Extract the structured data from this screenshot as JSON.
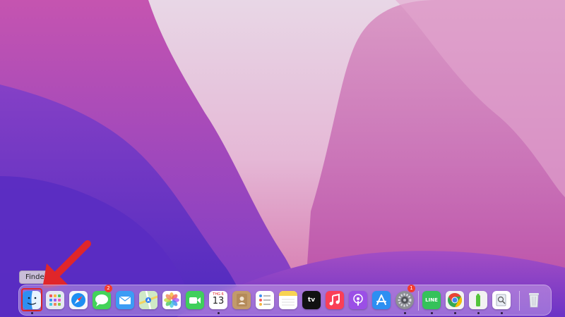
{
  "desktop": {
    "wallpaper": "macOS Monterey"
  },
  "tooltip": {
    "label": "Finder"
  },
  "annotation": {
    "arrow_color": "#e0262a",
    "highlight_color": "#e0262a"
  },
  "dock": {
    "apps": [
      {
        "id": "finder",
        "icon": "finder-icon",
        "running": true,
        "highlighted": true
      },
      {
        "id": "launchpad",
        "icon": "launchpad-icon",
        "running": false
      },
      {
        "id": "safari",
        "icon": "safari-icon",
        "running": false
      },
      {
        "id": "messages",
        "icon": "messages-icon",
        "running": false,
        "badge": "2"
      },
      {
        "id": "mail",
        "icon": "mail-icon",
        "running": false
      },
      {
        "id": "maps",
        "icon": "maps-icon",
        "running": false
      },
      {
        "id": "photos",
        "icon": "photos-icon",
        "running": false
      },
      {
        "id": "facetime",
        "icon": "facetime-icon",
        "running": false
      },
      {
        "id": "calendar",
        "icon": "calendar-icon",
        "running": true,
        "month": "THG 6",
        "day": "13"
      },
      {
        "id": "contacts",
        "icon": "contacts-icon",
        "running": false
      },
      {
        "id": "reminders",
        "icon": "reminders-icon",
        "running": false
      },
      {
        "id": "notes",
        "icon": "notes-icon",
        "running": false
      },
      {
        "id": "appletv",
        "icon": "tv-icon",
        "running": false,
        "label": "tv"
      },
      {
        "id": "music",
        "icon": "music-icon",
        "running": false
      },
      {
        "id": "podcasts",
        "icon": "podcasts-icon",
        "running": false
      },
      {
        "id": "appstore",
        "icon": "app-store-icon",
        "running": false
      },
      {
        "id": "system-preferences",
        "icon": "gear-icon",
        "running": true,
        "badge": "1"
      },
      {
        "id": "line",
        "icon": "line-icon",
        "running": true,
        "label": "LINE"
      },
      {
        "id": "chrome",
        "icon": "chrome-icon",
        "running": true
      },
      {
        "id": "battery-app",
        "icon": "battery-icon",
        "running": true
      },
      {
        "id": "preview",
        "icon": "preview-icon",
        "running": true
      },
      {
        "id": "trash",
        "icon": "trash-icon",
        "running": false
      }
    ]
  }
}
